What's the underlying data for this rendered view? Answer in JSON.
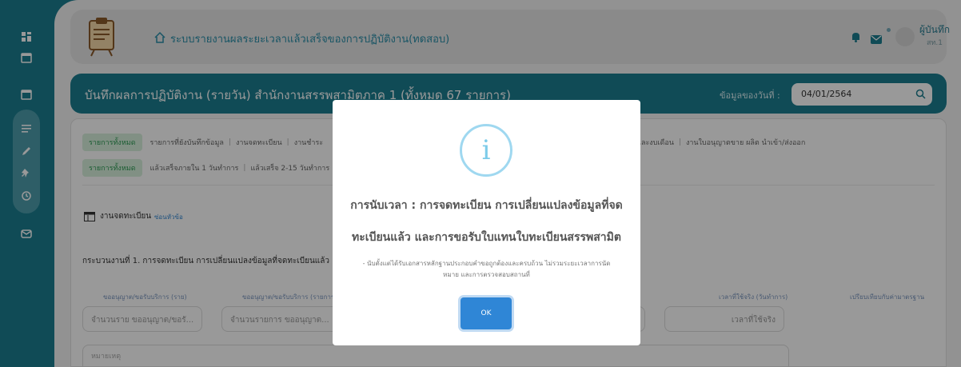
{
  "header": {
    "app_title": "ระบบรายงานผลระยะเวลาแล้วเสร็จของการปฏิบัติงาน(ทดสอบ)",
    "user_name": "ผู้บันทึก",
    "user_org": "สท.1"
  },
  "banner": {
    "title": "บันทึกผลการปฏิบัติงาน (รายวัน) สำนักงานสรรพสามิตภาค 1 (ทั้งหมด 67 รายการ)",
    "date_label": "ข้อมูลของวันที่ :",
    "date_value": "04/01/2564"
  },
  "tabs_row1": {
    "active": "รายการทั้งหมด",
    "items": [
      "รายการที่ยังบันทึกข้อมูล",
      "งานจดทะเบียน",
      "งานชำระ",
      "และงบเดือน",
      "งานใบอนุญาตขาย ผลิต นำเข้า/ส่งออก"
    ]
  },
  "tabs_row2": {
    "active": "รายการทั้งหมด",
    "items": [
      "แล้วเสร็จภายใน 1 วันทำการ",
      "แล้วเสร็จ 2-15 วันทำการ"
    ]
  },
  "section": {
    "title": "งานจดทะเบียน",
    "hide_label": "ซ่อนหัวข้อ",
    "process_title": "กระบวนงานที่ 1. การจดทะเบียน การเปลี่ยนแปลงข้อมูลที่จดทะเบียนแล้ว"
  },
  "columns": {
    "c1": "ขออนุญาต/ขอรับบริการ (ราย)",
    "c2": "ขออนุญาต/ขอรับบริการ (รายการ)",
    "c3": "เวลาที่ใช้จริง (วันทำการ)",
    "c4": "เปรียบเทียบกับค่ามาตรฐาน"
  },
  "inputs": {
    "i1_placeholder": "จำนวนราย ขออนุญาต/ขอรั...",
    "i2_placeholder": "จำนวนรายการ ขออนุญาต...",
    "i3_placeholder": "เวลาที่ใช้จริง",
    "note_placeholder": "หมายเหตุ"
  },
  "modal": {
    "icon_glyph": "i",
    "title_line1": "การนับเวลา : การจดทะเบียน การเปลี่ยนแปลงข้อมูลที่จด",
    "title_line2": "ทะเบียนแล้ว และการขอรับใบแทนใบทะเบียนสรรพสามิต",
    "text_line1": "- นับตั้งแต่ได้รับเอกสารหลักฐานประกอบคำขอถูกต้องและครบถ้วน ไม่รวมระยะเวลาการนัด",
    "text_line2": "หมาย และการตรวจสอบสถานที่",
    "ok_label": "OK"
  },
  "colors": {
    "primary": "#1c7d8f",
    "ok_button": "#2f86d6",
    "info_icon": "#7ccbe9"
  }
}
